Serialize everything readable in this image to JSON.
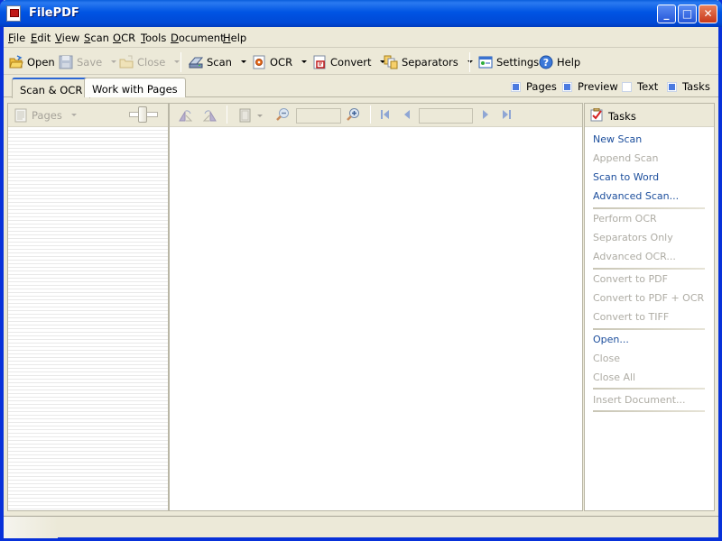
{
  "window": {
    "title": "FilePDF",
    "controls": {
      "minimize": "_",
      "maximize": "□",
      "close": "✕"
    }
  },
  "menubar": {
    "items": [
      {
        "label": "File",
        "accel": "F",
        "rest": "ile"
      },
      {
        "label": "Edit",
        "accel": "E",
        "rest": "dit"
      },
      {
        "label": "View",
        "accel": "V",
        "rest": "iew"
      },
      {
        "label": "Scan",
        "accel": "S",
        "rest": "can"
      },
      {
        "label": "OCR",
        "accel": "O",
        "rest": "CR"
      },
      {
        "label": "Tools",
        "accel": "T",
        "rest": "ools"
      },
      {
        "label": "Document",
        "accel": "D",
        "rest": "ocument"
      },
      {
        "label": "Help",
        "accel": "H",
        "rest": "elp"
      }
    ]
  },
  "toolbar": {
    "open": {
      "label": "Open",
      "icon": "folder-open-icon",
      "enabled": true
    },
    "save": {
      "label": "Save",
      "icon": "floppy-disk-icon",
      "enabled": false
    },
    "close": {
      "label": "Close",
      "icon": "folder-close-icon",
      "enabled": false
    },
    "scan": {
      "label": "Scan",
      "icon": "scanner-icon",
      "enabled": true
    },
    "ocr": {
      "label": "OCR",
      "icon": "ocr-gear-icon",
      "enabled": true
    },
    "convert": {
      "label": "Convert",
      "icon": "convert-pdf-icon",
      "enabled": true
    },
    "separators": {
      "label": "Separators",
      "icon": "separators-icon",
      "enabled": true
    },
    "settings": {
      "label": "Settings",
      "icon": "settings-window-icon",
      "enabled": true
    },
    "help": {
      "label": "Help",
      "icon": "help-question-icon",
      "enabled": true
    }
  },
  "tabs": [
    {
      "label": "Scan & OCR",
      "active": true
    },
    {
      "label": "Work with Pages",
      "active": false
    }
  ],
  "view_toggles": [
    {
      "label": "Pages",
      "checked": true
    },
    {
      "label": "Preview",
      "checked": true
    },
    {
      "label": "Text",
      "checked": false
    },
    {
      "label": "Tasks",
      "checked": true
    }
  ],
  "pages_panel": {
    "header_label": "Pages",
    "header_icon": "pages-document-icon"
  },
  "preview_panel": {
    "zoom_value": "",
    "page_value": ""
  },
  "tasks_panel": {
    "title": "Tasks",
    "groups": [
      [
        {
          "label": "New Scan",
          "enabled": true
        },
        {
          "label": "Append Scan",
          "enabled": false
        },
        {
          "label": "Scan to Word",
          "enabled": true
        },
        {
          "label": "Advanced Scan...",
          "enabled": true
        }
      ],
      [
        {
          "label": "Perform OCR",
          "enabled": false
        },
        {
          "label": "Separators Only",
          "enabled": false
        },
        {
          "label": "Advanced OCR...",
          "enabled": false
        }
      ],
      [
        {
          "label": "Convert to PDF",
          "enabled": false
        },
        {
          "label": "Convert to PDF + OCR",
          "enabled": false
        },
        {
          "label": "Convert to TIFF",
          "enabled": false
        }
      ],
      [
        {
          "label": "Open...",
          "enabled": true
        },
        {
          "label": "Close",
          "enabled": false
        },
        {
          "label": "Close All",
          "enabled": false
        }
      ],
      [
        {
          "label": "Insert Document...",
          "enabled": false
        }
      ]
    ]
  },
  "statusbar": {
    "text": ""
  }
}
